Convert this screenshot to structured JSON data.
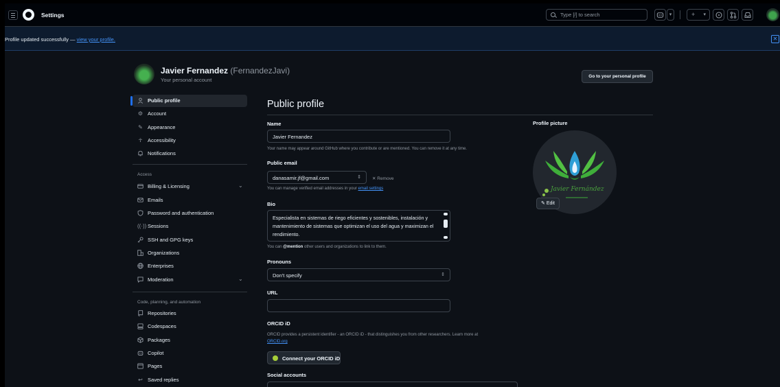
{
  "header": {
    "title": "Settings",
    "search_placeholder": "Type [/] to search",
    "copilot_icon": "copilot-icon",
    "plus_label": "+",
    "caret": "▾"
  },
  "flash": {
    "message": "Profile updated successfully —",
    "link": "view your profile.",
    "close": "✕"
  },
  "account": {
    "name": "Javier Fernandez",
    "login": "(FernandezJavi)",
    "subtitle": "Your personal account",
    "go_to_profile": "Go to your personal profile"
  },
  "nav": {
    "items_top": [
      {
        "label": "Public profile",
        "icon": "person-icon"
      },
      {
        "label": "Account",
        "icon": "gear-icon"
      },
      {
        "label": "Appearance",
        "icon": "paintbrush-icon"
      },
      {
        "label": "Accessibility",
        "icon": "accessibility-icon"
      },
      {
        "label": "Notifications",
        "icon": "bell-icon"
      }
    ],
    "group_access": "Access",
    "items_access": [
      {
        "label": "Billing & Licensing",
        "icon": "credit-card-icon"
      },
      {
        "label": "Emails",
        "icon": "mail-icon"
      },
      {
        "label": "Password and authentication",
        "icon": "shield-lock-icon"
      },
      {
        "label": "Sessions",
        "icon": "broadcast-icon"
      },
      {
        "label": "SSH and GPG keys",
        "icon": "key-icon"
      },
      {
        "label": "Organizations",
        "icon": "organization-icon"
      },
      {
        "label": "Enterprises",
        "icon": "globe-icon"
      },
      {
        "label": "Moderation",
        "icon": "report-icon"
      }
    ],
    "group_code": "Code, planning, and automation",
    "items_code": [
      {
        "label": "Repositories",
        "icon": "repo-icon"
      },
      {
        "label": "Codespaces",
        "icon": "codespaces-icon"
      },
      {
        "label": "Packages",
        "icon": "package-icon"
      },
      {
        "label": "Copilot",
        "icon": "copilot-icon"
      },
      {
        "label": "Pages",
        "icon": "browser-icon"
      },
      {
        "label": "Saved replies",
        "icon": "reply-icon"
      }
    ]
  },
  "main": {
    "title": "Public profile",
    "name_label": "Name",
    "name_value": "Javier Fernandez",
    "name_hint": "Your name may appear around GitHub where you contribute or are mentioned. You can remove it at any time.",
    "email_label": "Public email",
    "email_value": "danasamir.jf@gmail.com",
    "remove_label": "✕  Remove",
    "email_hint": "You can manage verified email addresses in your",
    "email_hint_link": "email settings",
    "bio_label": "Bio",
    "bio_value": "Especialista en sistemas de riego eficientes y sostenibles, instalación y mantenimiento de sistemas que optimizan el uso del agua y maximizan el rendimiento.",
    "bio_hint_pre": "You can",
    "bio_hint_mention": "@mention",
    "bio_hint_post": "other users and organizations to link to them.",
    "pronouns_label": "Pronouns",
    "pronouns_value": "Don't specify",
    "url_label": "URL",
    "url_value": "",
    "orcid_label": "ORCID iD",
    "orcid_hint": "ORCID provides a persistent identifier - an ORCID iD - that distinguishes you from other researchers. Learn more at",
    "orcid_link": "ORCID.org",
    "orcid_button": "Connect your ORCID iD",
    "social_label": "Social accounts"
  },
  "picture": {
    "label": "Profile picture",
    "logo_text": "Javier Fernández",
    "edit_label": "Edit"
  }
}
